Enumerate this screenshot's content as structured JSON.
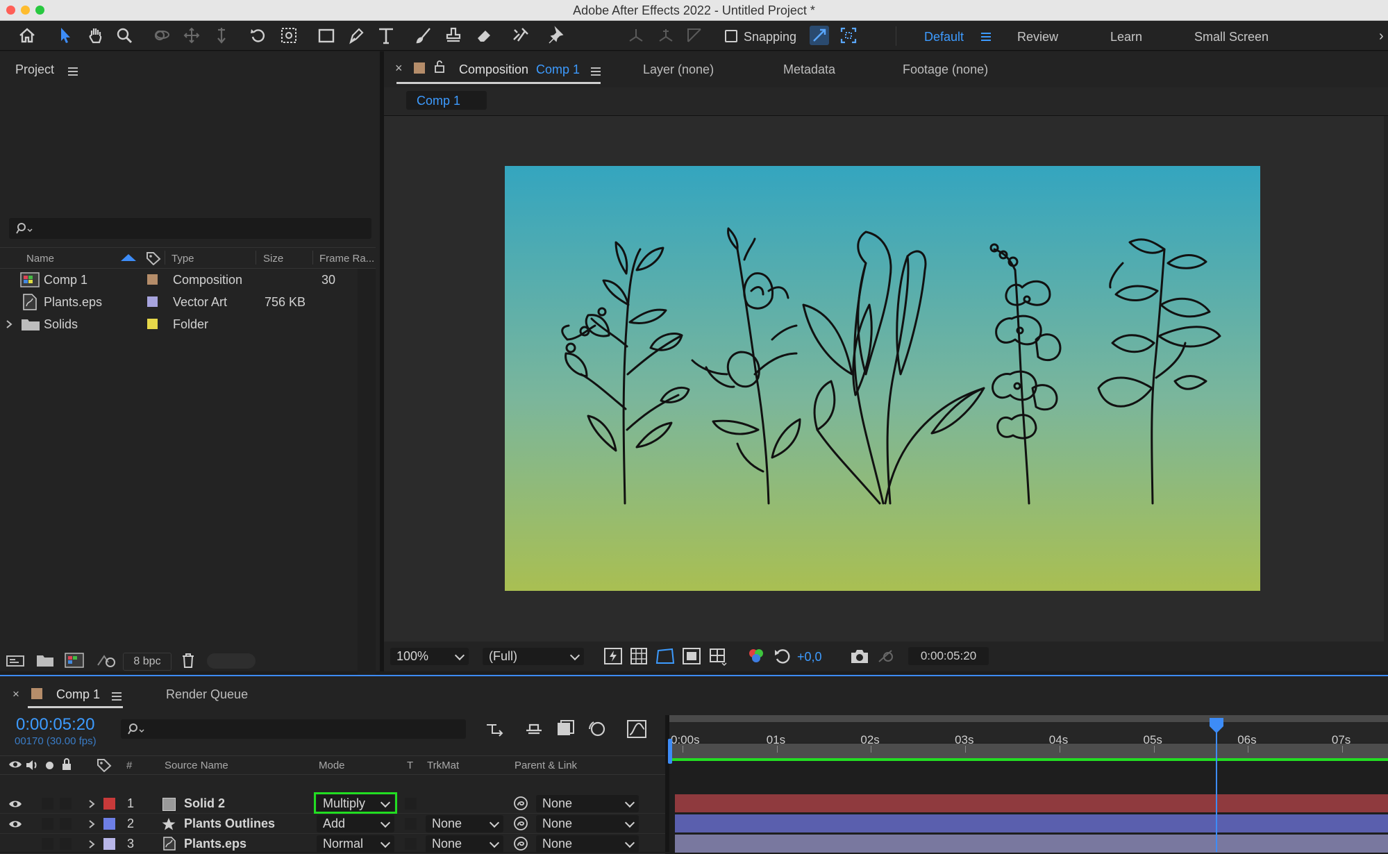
{
  "window": {
    "title": "Adobe After Effects 2022 - Untitled Project *"
  },
  "toolbar": {
    "snapping_label": "Snapping",
    "workspaces": [
      "Default",
      "Review",
      "Learn",
      "Small Screen"
    ]
  },
  "project_panel": {
    "title": "Project",
    "columns": {
      "name": "Name",
      "type": "Type",
      "size": "Size",
      "frame_rate": "Frame Ra..."
    },
    "items": [
      {
        "name": "Comp 1",
        "type": "Composition",
        "size": "",
        "frame_rate": "30",
        "label_color": "#b58d6a",
        "icon": "composition-icon"
      },
      {
        "name": "Plants.eps",
        "type": "Vector Art",
        "size": "756 KB",
        "frame_rate": "",
        "label_color": "#a7a4de",
        "icon": "vector-file-icon"
      },
      {
        "name": "Solids",
        "type": "Folder",
        "size": "",
        "frame_rate": "",
        "label_color": "#e6d84a",
        "icon": "folder-icon"
      }
    ],
    "bpc": "8 bpc"
  },
  "viewer": {
    "tabs": {
      "composition_prefix": "Composition",
      "composition_name": "Comp 1",
      "layer": "Layer (none)",
      "metadata": "Metadata",
      "footage": "Footage (none)"
    },
    "breadcrumb": "Comp 1",
    "zoom": "100%",
    "resolution": "(Full)",
    "exposure": "+0,0",
    "timecode": "0:00:05:20",
    "gradient_top": "#34a5bf",
    "gradient_bottom": "#a9bf52"
  },
  "timeline": {
    "tab_title": "Comp 1",
    "render_queue": "Render Queue",
    "timecode": "0:00:05:20",
    "frame_info": "00170 (30.00 fps)",
    "columns": {
      "num": "#",
      "source_name": "Source Name",
      "mode": "Mode",
      "t": "T",
      "trkmat": "TrkMat",
      "parent": "Parent & Link"
    },
    "layers": [
      {
        "num": "1",
        "name": "Solid 2",
        "mode": "Multiply",
        "trkmat": "",
        "parent": "None",
        "color": "#c83a3a",
        "bar_color": "#8f3a3e",
        "visible": true
      },
      {
        "num": "2",
        "name": "Plants Outlines",
        "mode": "Add",
        "trkmat": "None",
        "parent": "None",
        "color": "#6e7fe6",
        "bar_color": "#5a5fae",
        "visible": true
      },
      {
        "num": "3",
        "name": "Plants.eps",
        "mode": "Normal",
        "trkmat": "None",
        "parent": "None",
        "color": "#b8b6e8",
        "bar_color": "#79789f",
        "visible": false
      }
    ],
    "ruler": [
      "0:00s",
      "01s",
      "02s",
      "03s",
      "04s",
      "05s",
      "06s",
      "07s"
    ],
    "playhead_seconds": 5.67,
    "accent": "#3aa0ff",
    "highlight": "#22dd22"
  }
}
